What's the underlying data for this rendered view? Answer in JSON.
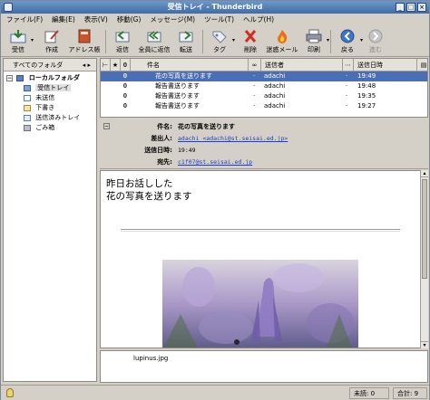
{
  "window": {
    "title": "受信トレイ - Thunderbird"
  },
  "menu": [
    "ファイル(F)",
    "編集(E)",
    "表示(V)",
    "移動(G)",
    "メッセージ(M)",
    "ツール(T)",
    "ヘルプ(H)"
  ],
  "toolbar": [
    {
      "label": "受信",
      "icon": "receive-icon",
      "dropdown": true
    },
    {
      "label": "作成",
      "icon": "compose-icon"
    },
    {
      "label": "アドレス帳",
      "icon": "address-book-icon"
    },
    {
      "label": "返信",
      "icon": "reply-icon"
    },
    {
      "label": "全員に返信",
      "icon": "reply-all-icon"
    },
    {
      "label": "転送",
      "icon": "forward-icon"
    },
    {
      "label": "タグ",
      "icon": "tag-icon",
      "dropdown": true
    },
    {
      "label": "削除",
      "icon": "delete-icon"
    },
    {
      "label": "迷惑メール",
      "icon": "junk-icon"
    },
    {
      "label": "印刷",
      "icon": "print-icon",
      "dropdown": true
    },
    {
      "label": "戻る",
      "icon": "back-icon",
      "dropdown": true
    },
    {
      "label": "進む",
      "icon": "forward-nav-icon"
    }
  ],
  "folders": {
    "header": "すべてのフォルダ",
    "header_arrows": "◂ ▸",
    "items": [
      {
        "label": "ローカルフォルダ",
        "level": 0,
        "bold": true
      },
      {
        "label": "受信トレイ",
        "level": 1,
        "selected": true
      },
      {
        "label": "未送信",
        "level": 1
      },
      {
        "label": "下書き",
        "level": 1
      },
      {
        "label": "送信済みトレイ",
        "level": 1
      },
      {
        "label": "ごみ箱",
        "level": 1
      }
    ]
  },
  "threads": {
    "columns": {
      "subject": "件名",
      "sender": "送信者",
      "date": "送信日時"
    },
    "rows": [
      {
        "subject": "花の写真を送ります",
        "sender": "adachi",
        "date": "19:49",
        "selected": true
      },
      {
        "subject": "報告書送ります",
        "sender": "adachi",
        "date": "19:48"
      },
      {
        "subject": "報告書送ります",
        "sender": "adachi",
        "date": "19:35"
      },
      {
        "subject": "報告書送ります",
        "sender": "adachi",
        "date": "19:27"
      }
    ]
  },
  "header": {
    "subject_label": "件名:",
    "subject": "花の写真を送ります",
    "from_label": "差出人:",
    "from": "adachi <adachi@st.seisai.ed.jp>",
    "date_label": "送信日時:",
    "date": "19:49",
    "to_label": "宛先:",
    "to": "c1f07@st.seisai.ed.jp"
  },
  "body": {
    "line1": "昨日お話しした",
    "line2": "花の写真を送ります"
  },
  "attachment": {
    "name": "lupinus.jpg"
  },
  "status": {
    "unread_label": "未読: 0",
    "total_label": "合計: 9"
  },
  "colors": {
    "selection": "#4b6fb4",
    "titlebar": "#3f6ca6",
    "link": "#1a3ccc"
  }
}
